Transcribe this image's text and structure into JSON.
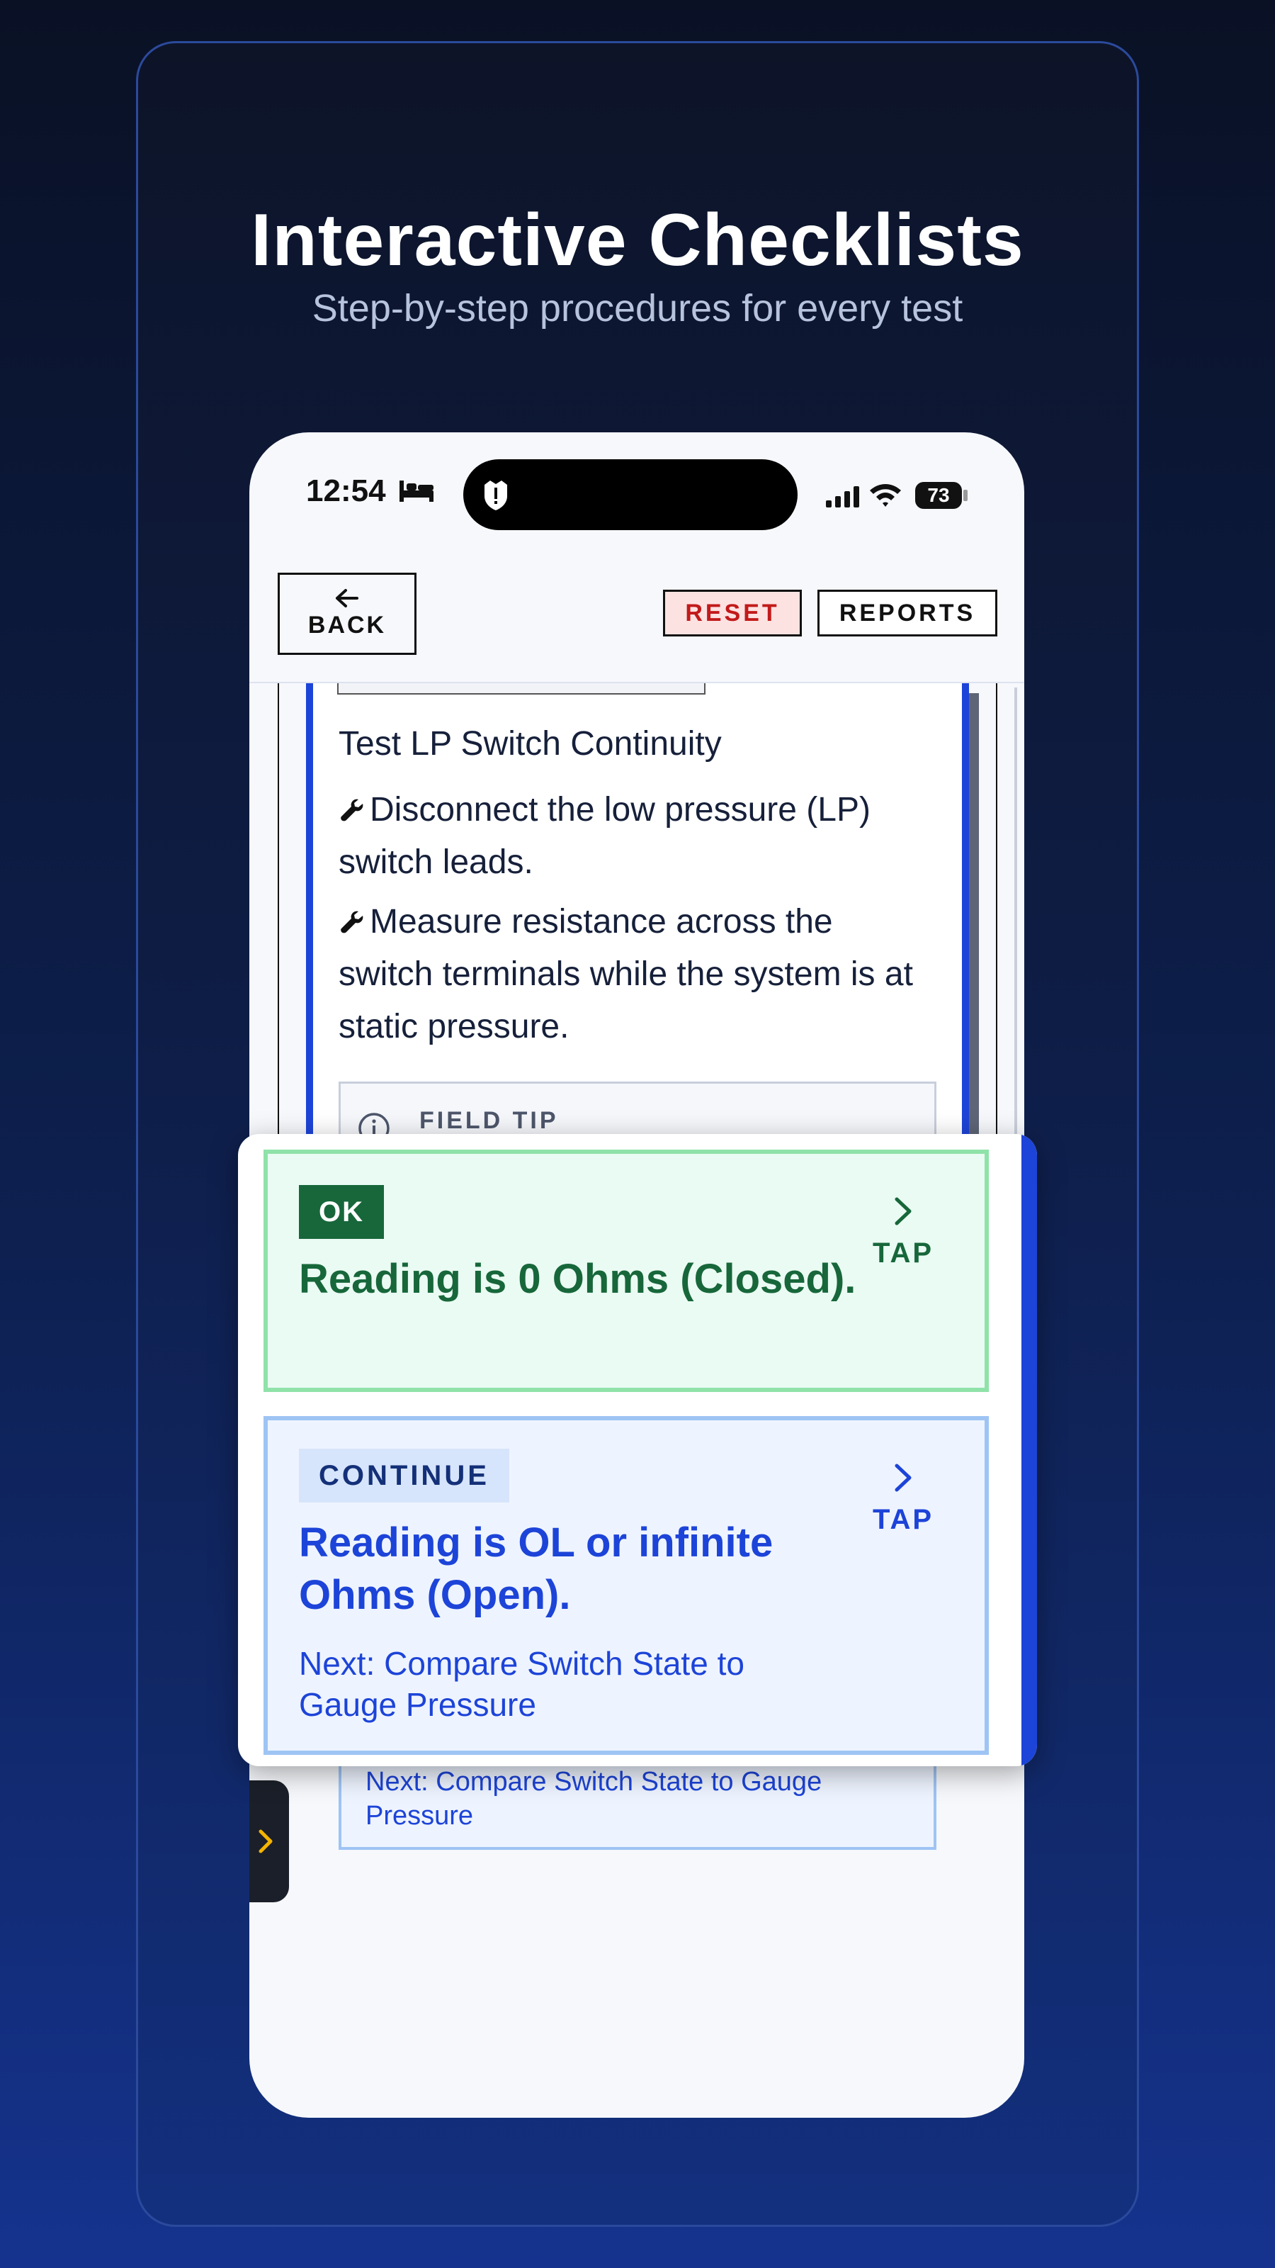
{
  "hero": {
    "title": "Interactive Checklists",
    "subtitle": "Step-by-step procedures for every test"
  },
  "status_bar": {
    "time": "12:54",
    "battery": "73"
  },
  "header": {
    "back_label": "BACK",
    "reset_label": "RESET",
    "reports_label": "REPORTS"
  },
  "step": {
    "title": "Test LP Switch Continuity",
    "instructions": [
      "Disconnect the low pressure (LP) switch leads.",
      "Measure resistance across the switch terminals while the system is at static pressure."
    ],
    "tip_label": "FIELD TIP"
  },
  "options": [
    {
      "badge": "OK",
      "title": "Reading is 0 Ohms (Closed).",
      "tap_label": "TAP"
    },
    {
      "badge": "CONTINUE",
      "title": "Reading is OL or infinite Ohms (Open).",
      "next": "Next: Compare Switch State to Gauge Pressure",
      "tap_label": "TAP"
    }
  ],
  "colors": {
    "ok_green": "#17673a",
    "continue_blue": "#1d44d8",
    "reset_red": "#c21a1a"
  }
}
